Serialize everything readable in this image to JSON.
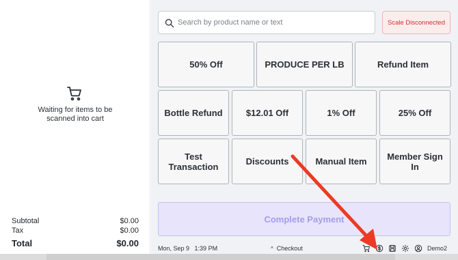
{
  "cart": {
    "empty_message": "Waiting for items to be scanned into cart",
    "icon": "cart-icon"
  },
  "totals": {
    "subtotal_label": "Subtotal",
    "subtotal_value": "$0.00",
    "tax_label": "Tax",
    "tax_value": "$0.00",
    "total_label": "Total",
    "total_value": "$0.00"
  },
  "search": {
    "placeholder": "Search by product name or text",
    "value": ""
  },
  "scale_status": "Scale Disconnected",
  "tiles": [
    "50% Off",
    "PRODUCE PER LB",
    "Refund Item",
    "Bottle Refund",
    "$12.01 Off",
    "1% Off",
    "25% Off",
    "Test Transaction",
    "Discounts",
    "Manual Item",
    "Member Sign In"
  ],
  "complete_payment_label": "Complete Payment",
  "status_bar": {
    "date": "Mon, Sep 9",
    "time": "1:39 PM",
    "checkout_label": "Checkout",
    "user": "Demo2",
    "icons": [
      "cart-icon",
      "dollar-coin-icon",
      "save-icon",
      "gear-icon",
      "user-circle-icon"
    ]
  },
  "colors": {
    "accent_purple": "#a59ce8",
    "danger_red": "#d0312d",
    "annotation_red": "#ec3a24"
  }
}
